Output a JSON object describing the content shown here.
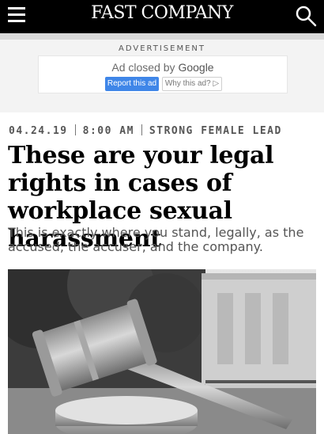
{
  "header": {
    "logo_text": "FAST COMPANY",
    "menu_icon": "hamburger-icon",
    "search_icon": "search-icon",
    "background": "#000000"
  },
  "ad": {
    "label": "ADVERTISEMENT",
    "closed_text": "Ad closed by ",
    "google_text": "Google",
    "report_button": "Report this ad",
    "why_button": "Why this ad?",
    "accent": "#3F86E8"
  },
  "article": {
    "date": "04.24.19",
    "time": "8:00 AM",
    "category": "STRONG FEMALE LEAD",
    "headline": "These are your legal rights in cases of workplace sexual harassment",
    "subhead": "This is exactly where you stand, legally, as the accused, the accuser, and the company.",
    "image_subject": "gavel-photo"
  }
}
